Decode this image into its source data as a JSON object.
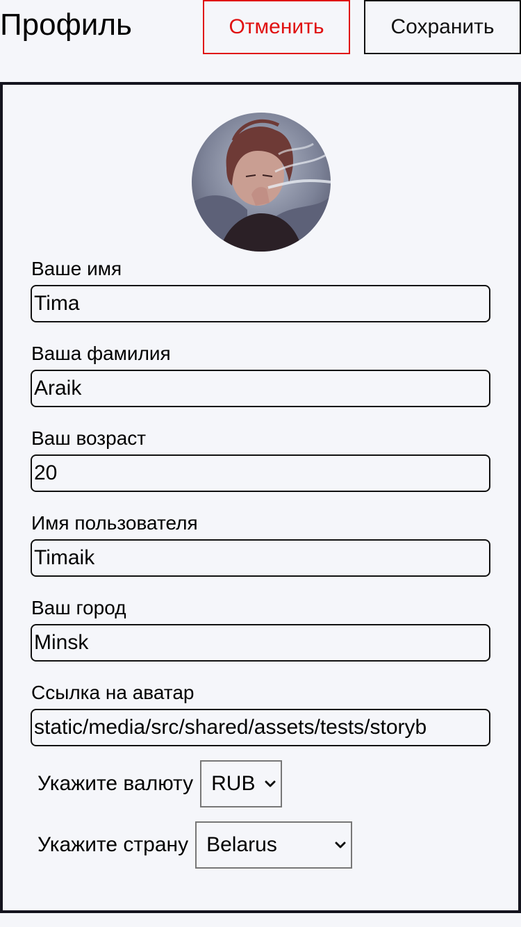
{
  "header": {
    "title": "Профиль",
    "cancel_label": "Отменить",
    "save_label": "Сохранить"
  },
  "colors": {
    "cancel": "#e01010",
    "border": "#14141e",
    "background": "#f5f6fa"
  },
  "profile": {
    "first_name_label": "Ваше имя",
    "first_name": "Tima",
    "last_name_label": "Ваша фамилия",
    "last_name": "Araik",
    "age_label": "Ваш возраст",
    "age": "20",
    "username_label": "Имя пользователя",
    "username": "Timaik",
    "city_label": "Ваш город",
    "city": "Minsk",
    "avatar_label": "Ссылка на аватар",
    "avatar_url": "static/media/src/shared/assets/tests/storyb",
    "currency_label": "Укажите валюту",
    "currency": "RUB",
    "country_label": "Укажите страну",
    "country": "Belarus"
  },
  "icons": {
    "avatar": "avatar-image",
    "select_arrow": "chevron-down-icon"
  }
}
